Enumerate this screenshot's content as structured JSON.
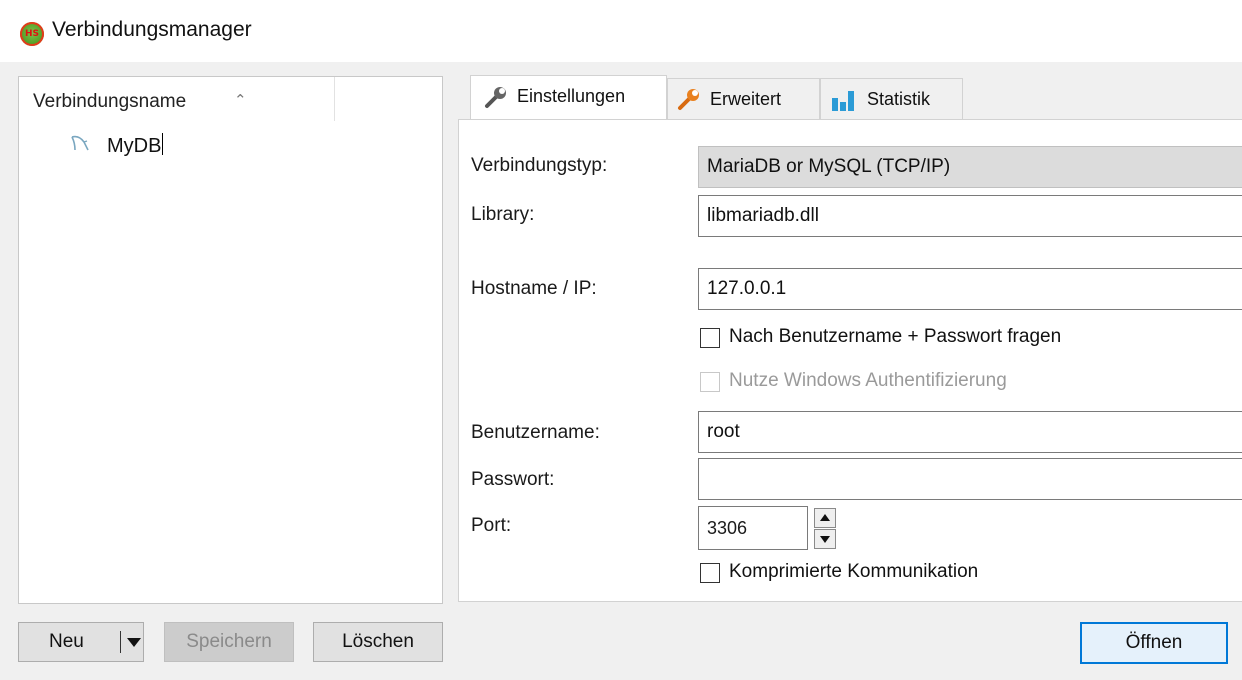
{
  "window": {
    "title": "Verbindungsmanager",
    "app_icon_text": "HS"
  },
  "tree": {
    "column_header": "Verbindungsname",
    "sort_icon": "chevron-up-icon",
    "items": [
      {
        "label": "MyDB",
        "icon": "dolphin-db-icon"
      }
    ]
  },
  "buttons": {
    "new": "Neu",
    "save": "Speichern",
    "delete": "Löschen",
    "open": "Öffnen"
  },
  "tabs": [
    {
      "label": "Einstellungen",
      "icon": "wrench-icon",
      "active": true
    },
    {
      "label": "Erweitert",
      "icon": "wrench-orange-icon",
      "active": false
    },
    {
      "label": "Statistik",
      "icon": "bar-chart-icon",
      "active": false
    }
  ],
  "settings": {
    "connection_type_label": "Verbindungstyp:",
    "connection_type_value": "MariaDB or MySQL (TCP/IP)",
    "library_label": "Library:",
    "library_value": "libmariadb.dll",
    "hostname_label": "Hostname / IP:",
    "hostname_value": "127.0.0.1",
    "prompt_credentials_label": "Nach Benutzername + Passwort fragen",
    "prompt_credentials_checked": false,
    "windows_auth_label": "Nutze Windows Authentifizierung",
    "windows_auth_checked": false,
    "username_label": "Benutzername:",
    "username_value": "root",
    "password_label": "Passwort:",
    "password_value": "",
    "port_label": "Port:",
    "port_value": "3306",
    "compression_label": "Komprimierte Kommunikation",
    "compression_checked": false
  },
  "colors": {
    "focus_border": "#0078d7",
    "disabled_text": "#9a9a9a"
  }
}
